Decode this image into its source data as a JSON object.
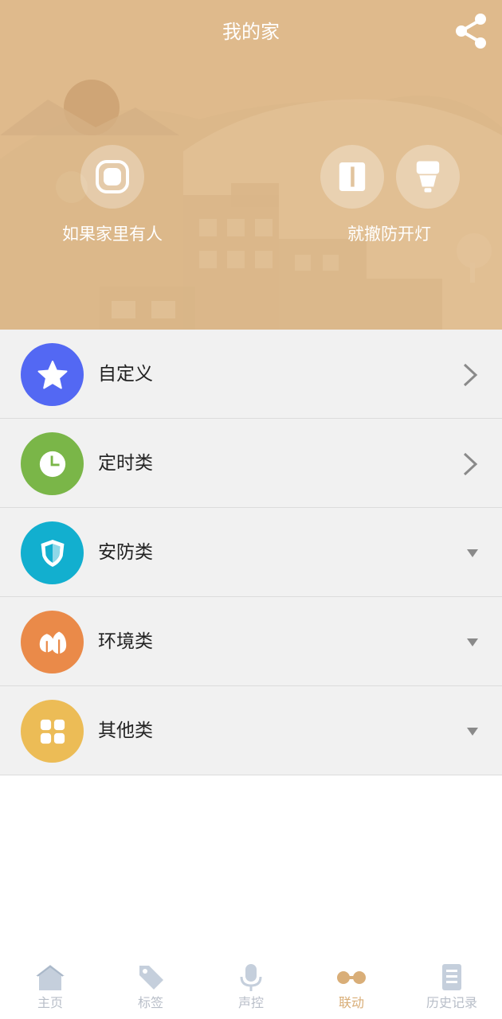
{
  "header": {
    "title": "我的家",
    "share_icon": "share-icon",
    "bg_color": "#dfba8c"
  },
  "scene": {
    "condition_label": "如果家里有人",
    "condition_icon": "sensor-square-icon",
    "action_label": "就撤防开灯",
    "action_icons": [
      "door-sensor-icon",
      "bulb-icon"
    ]
  },
  "categories": [
    {
      "label": "自定义",
      "icon": "star-icon",
      "color": "#5368f3",
      "indicator": "chevron-right"
    },
    {
      "label": "定时类",
      "icon": "clock-icon",
      "color": "#7ab648",
      "indicator": "chevron-right"
    },
    {
      "label": "安防类",
      "icon": "shield-icon",
      "color": "#12afcf",
      "indicator": "triangle-down"
    },
    {
      "label": "环境类",
      "icon": "trees-icon",
      "color": "#ea8a49",
      "indicator": "triangle-down"
    },
    {
      "label": "其他类",
      "icon": "grid-icon",
      "color": "#ecbc56",
      "indicator": "triangle-down"
    }
  ],
  "tabbar": {
    "items": [
      {
        "label": "主页",
        "icon": "home-icon",
        "active": false
      },
      {
        "label": "标签",
        "icon": "tag-icon",
        "active": false
      },
      {
        "label": "声控",
        "icon": "microphone-icon",
        "active": false
      },
      {
        "label": "联动",
        "icon": "link-icon",
        "active": true
      },
      {
        "label": "历史记录",
        "icon": "document-icon",
        "active": false
      }
    ],
    "active_color": "#d9ae78",
    "inactive_color": "#b8bec8"
  }
}
